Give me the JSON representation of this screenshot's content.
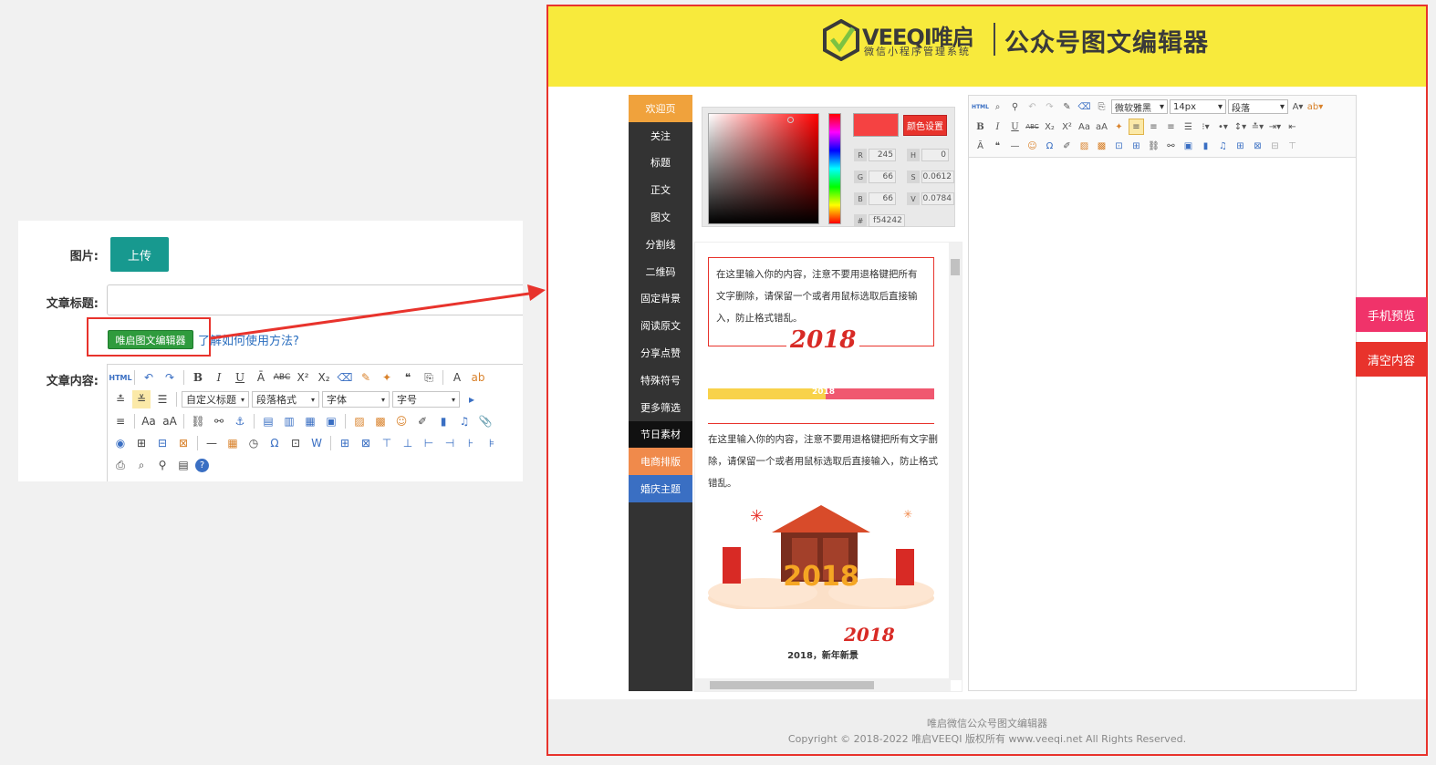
{
  "form": {
    "image_label": "图片:",
    "upload_label": "上传",
    "title_label": "文章标题:",
    "title_value": "",
    "editor_button_label": "唯启图文编辑器",
    "howto_link": "了解如何使用方法?",
    "content_label": "文章内容:",
    "toolbar": {
      "custom_title": "自定义标题",
      "paragraph": "段落格式",
      "font": "字体",
      "size": "字号"
    }
  },
  "banner": {
    "brand": "VEEQI唯启",
    "brand_sub": "微信小程序管理系统",
    "title": "公众号图文编辑器"
  },
  "nav": {
    "items": [
      {
        "label": "欢迎页",
        "style": "active"
      },
      {
        "label": "关注",
        "style": ""
      },
      {
        "label": "标题",
        "style": ""
      },
      {
        "label": "正文",
        "style": ""
      },
      {
        "label": "图文",
        "style": ""
      },
      {
        "label": "分割线",
        "style": ""
      },
      {
        "label": "二维码",
        "style": ""
      },
      {
        "label": "固定背景",
        "style": ""
      },
      {
        "label": "阅读原文",
        "style": ""
      },
      {
        "label": "分享点赞",
        "style": ""
      },
      {
        "label": "特殊符号",
        "style": ""
      },
      {
        "label": "更多筛选",
        "style": ""
      },
      {
        "label": "节日素材",
        "style": "black"
      },
      {
        "label": "电商排版",
        "style": "orange"
      },
      {
        "label": "婚庆主题",
        "style": "blue"
      }
    ]
  },
  "color_picker": {
    "set_label": "颜色设置",
    "r": "245",
    "g": "66",
    "b": "66",
    "h": "0",
    "s": "0.0612",
    "v": "0.0784",
    "hex": "f54242",
    "color": "#f54242"
  },
  "templates": {
    "text1": "在这里输入你的内容，注意不要用退格键把所有文字删除，请保留一个或者用鼠标选取后直接输入，防止格式错乱。",
    "year_art": "2018",
    "bar_text": "2018",
    "text2": "在这里输入你的内容，注意不要用退格键把所有文字删除，请保留一个或者用鼠标选取后直接输入，防止格式错乱。",
    "image_year": "2018",
    "caption_year": "2018",
    "caption": "2018，新年新景"
  },
  "right_editor": {
    "font": "微软雅黑",
    "size": "14px",
    "paragraph": "段落"
  },
  "footer": {
    "line1": "唯启微信公众号图文编辑器",
    "line2": "Copyright © 2018-2022 唯启VEEQI 版权所有 www.veeqi.net All Rights Reserved."
  },
  "side": {
    "preview_label": "手机预览",
    "preview_color": "#f0336a",
    "clear_label": "清空内容",
    "clear_color": "#e8332c"
  }
}
